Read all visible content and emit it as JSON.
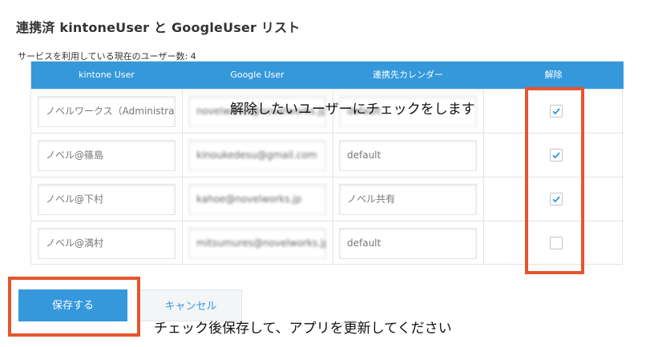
{
  "page": {
    "title": "連携済 kintoneUser と GoogleUser リスト",
    "count_label": "サービスを利用している現在のユーザー数: 4"
  },
  "table": {
    "headers": [
      "kintone User",
      "Google User",
      "連携先カレンダー",
      "解除"
    ],
    "rows": [
      {
        "kintone": "ノベルワークス（Administrat",
        "google": "novelworks@novelworks.jp",
        "calendar": "default",
        "checked": true
      },
      {
        "kintone": "ノベル@篠島",
        "google": "kinoukedesu@gmail.com",
        "calendar": "default",
        "checked": true
      },
      {
        "kintone": "ノベル@下村",
        "google": "kahoe@novelworks.jp",
        "calendar": "ノベル共有",
        "checked": true
      },
      {
        "kintone": "ノベル@満村",
        "google": "mitsumures@novelworks.jp",
        "calendar": "default",
        "checked": false
      }
    ]
  },
  "annotations": {
    "check_hint": "解除したいユーザーにチェックをします",
    "save_hint": "チェック後保存して、アプリを更新してください"
  },
  "buttons": {
    "save": "保存する",
    "cancel": "キャンセル"
  },
  "colors": {
    "accent": "#3498db",
    "highlight": "#e6552b"
  }
}
